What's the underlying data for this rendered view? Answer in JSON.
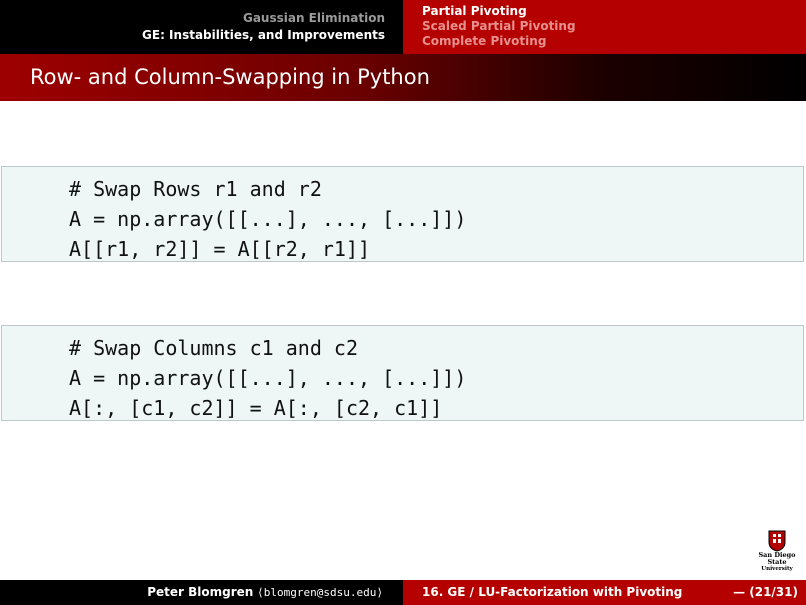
{
  "header": {
    "section": "Gaussian Elimination",
    "subsection": "GE: Instabilities, and Improvements",
    "nav_items": [
      {
        "label": "Partial Pivoting",
        "active": true
      },
      {
        "label": "Scaled Partial Pivoting",
        "active": false
      },
      {
        "label": "Complete Pivoting",
        "active": false
      }
    ]
  },
  "slide": {
    "title": "Row- and Column-Swapping in Python",
    "code_blocks": [
      {
        "lines": [
          "# Swap Rows r1 and r2",
          "A = np.array([[...], ..., [...]])",
          "A[[r1, r2]] = A[[r2, r1]]"
        ]
      },
      {
        "lines": [
          "# Swap Columns c1 and c2",
          "A = np.array([[...], ..., [...]])",
          "A[:, [c1, c2]] = A[:, [c2, c1]]"
        ]
      }
    ]
  },
  "logo": {
    "line1": "San Diego State",
    "line2": "University"
  },
  "footer": {
    "author": "Peter Blomgren",
    "email": "⟨blomgren@sdsu.edu⟩",
    "course": "16. GE / LU-Factorization with Pivoting",
    "page": "— (21/31)"
  },
  "colors": {
    "header_dark": "#000000",
    "header_red": "#b50000",
    "code_bg": "#eef6f6"
  }
}
